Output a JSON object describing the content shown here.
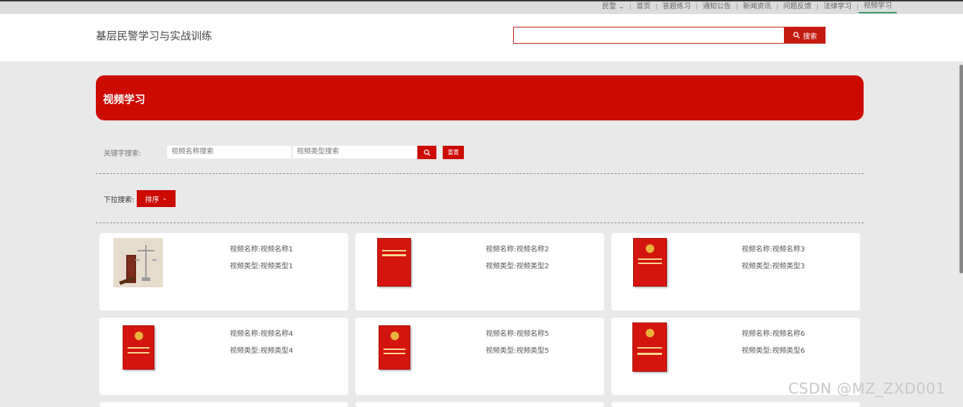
{
  "topnav": {
    "dropdown_label": "民警",
    "items": [
      "首页",
      "答题练习",
      "通知公告",
      "新闻资讯",
      "问题反馈",
      "法律学习",
      "视频学习"
    ],
    "active_index": 6
  },
  "header": {
    "site_title": "基层民警学习与实战训练",
    "search_value": "",
    "search_button": "搜索"
  },
  "banner": {
    "title": "视频学习"
  },
  "filter": {
    "keyword_label": "关键字搜索:",
    "name_placeholder": "视频名称搜索",
    "type_placeholder": "视频类型搜索",
    "reset_label": "重置"
  },
  "dropdown": {
    "label": "下拉搜索:",
    "sort_label": "排序"
  },
  "videos": [
    {
      "name": "视频名称:视频名称1",
      "type": "视频类型:视频类型1",
      "thumb": "scales-gavel"
    },
    {
      "name": "视频名称:视频名称2",
      "type": "视频类型:视频类型2",
      "thumb": "law-book"
    },
    {
      "name": "视频名称:视频名称3",
      "type": "视频类型:视频类型3",
      "thumb": "law-book"
    },
    {
      "name": "视频名称:视频名称4",
      "type": "视频类型:视频类型4",
      "thumb": "law-book"
    },
    {
      "name": "视频名称:视频名称5",
      "type": "视频类型:视频类型5",
      "thumb": "law-book"
    },
    {
      "name": "视频名称:视频名称6",
      "type": "视频类型:视频类型6",
      "thumb": "law-book"
    }
  ],
  "watermark": "CSDN @MZ_ZXD001",
  "colors": {
    "accent": "#cc0a00",
    "active_nav": "#3a9a6a"
  }
}
